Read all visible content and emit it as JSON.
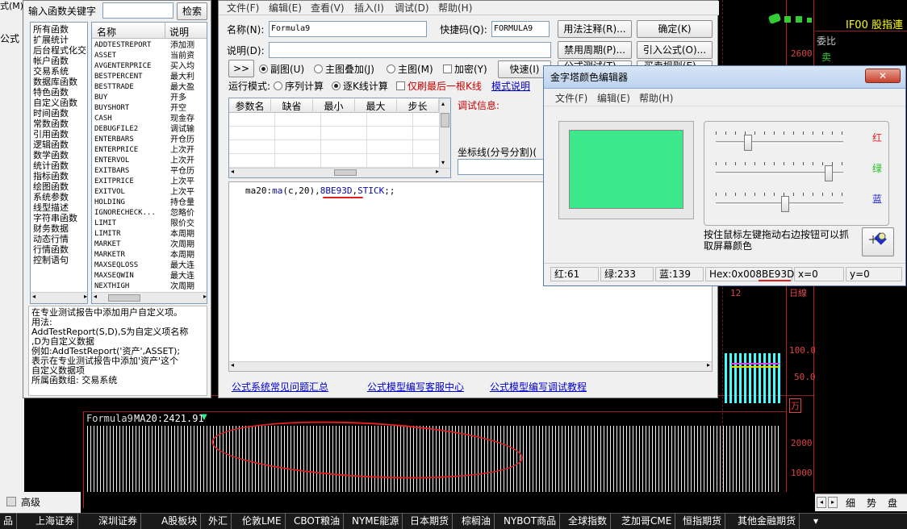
{
  "bg": {
    "top_left_menu": "式(M)",
    "side_label_gongshi": "公式",
    "chart_title": "Formula9",
    "chart_ma": "MA20:2421.91",
    "y_ticks_bottom": [
      "2000",
      "1000"
    ],
    "y_ticks_mid": [
      "100.0",
      "50.0",
      "万"
    ],
    "right_label_2600": "2600",
    "right_label_riding": "日線",
    "right_label_12": "12",
    "right_panel": {
      "ticker": "IF00 股指連",
      "weibi": "委比",
      "mai": "卖"
    },
    "bottom_left": "高级",
    "bottom_right_tabs": [
      "细",
      "势",
      "盘"
    ],
    "tabs": [
      "品",
      "上海证券",
      "深圳证券",
      "A股板块",
      "外汇",
      "伦敦LME",
      "CBOT粮油",
      "NYME能源",
      "日本期货",
      "棕榈油",
      "NYBOT商品",
      "全球指数",
      "芝加哥CME",
      "恒指期货",
      "其他金融期货"
    ],
    "tab_arrow": "▾"
  },
  "func_panel": {
    "search_label": "输入函数关键字",
    "search_value": "",
    "search_button": "检索",
    "categories": [
      "所有函数",
      "扩展统计",
      "后台程式化交易",
      "帐户函数",
      "交易系统",
      "数据库函数",
      "特色函数",
      "自定义函数",
      "时间函数",
      "常数函数",
      "引用函数",
      "逻辑函数",
      "数学函数",
      "统计函数",
      "指标函数",
      "绘图函数",
      "系统参数",
      "线型描述",
      "字符串函数",
      "财务数据",
      "动态行情",
      "行情函数",
      "控制语句"
    ],
    "col_name": "名称",
    "col_desc": "说明",
    "functions": [
      {
        "name": "ADDTESTREPORT",
        "desc": "添加测"
      },
      {
        "name": "ASSET",
        "desc": "当前资"
      },
      {
        "name": "AVGENTERPRICE",
        "desc": "买入均"
      },
      {
        "name": "BESTPERCENT",
        "desc": "最大利"
      },
      {
        "name": "BESTTRADE",
        "desc": "最大盈"
      },
      {
        "name": "BUY",
        "desc": "开多"
      },
      {
        "name": "BUYSHORT",
        "desc": "开空"
      },
      {
        "name": "CASH",
        "desc": "现金存"
      },
      {
        "name": "DEBUGFILE2",
        "desc": "调试输"
      },
      {
        "name": "ENTERBARS",
        "desc": "开仓历"
      },
      {
        "name": "ENTERPRICE",
        "desc": "上次开"
      },
      {
        "name": "ENTERVOL",
        "desc": "上次开"
      },
      {
        "name": "EXITBARS",
        "desc": "平仓历"
      },
      {
        "name": "EXITPRICE",
        "desc": "上次平"
      },
      {
        "name": "EXITVOL",
        "desc": "上次平"
      },
      {
        "name": "HOLDING",
        "desc": "持仓量"
      },
      {
        "name": "IGNORECHECK...",
        "desc": "忽略价"
      },
      {
        "name": "LIMIT",
        "desc": "限价交"
      },
      {
        "name": "LIMITR",
        "desc": "本周期"
      },
      {
        "name": "MARKET",
        "desc": "次周期"
      },
      {
        "name": "MARKETR",
        "desc": "本周期"
      },
      {
        "name": "MAXSEQLOSS",
        "desc": "最大连"
      },
      {
        "name": "MAXSEQWIN",
        "desc": "最大连"
      },
      {
        "name": "NEXTHIGH",
        "desc": "次周期"
      }
    ],
    "help_lines": [
      "在专业测试报告中添加用户自定义项。",
      "用法:",
      "AddTestReport(S,D),S为自定义项名称",
      ",D为自定义数据",
      "例如:AddTestReport('资产',ASSET);",
      "表示在专业测试报告中添加'资产'这个",
      "自定义数据项",
      "所属函数组: 交易系统"
    ]
  },
  "editor": {
    "menu": [
      "文件(F)",
      "编辑(E)",
      "查看(V)",
      "插入(I)",
      "调试(D)",
      "帮助(H)"
    ],
    "name_label": "名称(N):",
    "name_value": "Formula9",
    "shortcut_label": "快捷码(Q):",
    "shortcut_value": "FORMULA9",
    "desc_label": "说明(D):",
    "desc_value": "",
    "btn_annotate": "用法注释(R)...",
    "btn_ok": "确定(K)",
    "btn_disable_period": "禁用周期(P)...",
    "btn_import": "引入公式(O)...",
    "btn_test": "公式测试(T)...",
    "btn_compare": "买卖规则(E)...",
    "btn_expand": ">>",
    "btn_quick": "快速(I)",
    "radio_subplot": "副图(U)",
    "radio_overlay": "主图叠加(J)",
    "radio_main": "主图(M)",
    "chk_encrypt": "加密(Y)",
    "run_mode_label": "运行模式:",
    "radio_seq": "序列计算",
    "radio_bar": "逐K线计算",
    "chk_last_bar": "仅刷最后一根K线",
    "mode_help": "模式说明",
    "param_headers": [
      "参数名",
      "缺省",
      "最小",
      "最大",
      "步长"
    ],
    "debug_label": "调试信息:",
    "axis_label": "坐标线(分号分割)(",
    "code_prefix": "ma20:",
    "code_fn": "ma",
    "code_args": "(c,20),",
    "code_color": "8BE93D",
    "code_comma": ",",
    "code_stick": "STICK",
    "code_tail": ";;",
    "links": [
      "公式系统常见问题汇总",
      "公式模型编写客服中心",
      "公式模型编写调试教程"
    ]
  },
  "color_editor": {
    "title": "金字塔颜色编辑器",
    "menu": [
      "文件(F)",
      "编辑(E)",
      "帮助(H)"
    ],
    "label_red": "红",
    "label_green": "绿",
    "label_blue": "蓝",
    "red_value": 61,
    "green_value": 233,
    "blue_value": 139,
    "hint": "按住鼠标左键拖动右边按钮可以抓取屏幕颜色",
    "status_red": "红:61",
    "status_green": "绿:233",
    "status_blue": "蓝:139",
    "status_hex_prefix": "Hex:0x00",
    "status_hex_value": "8BE93D",
    "status_x": "x=0",
    "status_y": "y=0",
    "swatch_color": "#3DE98B",
    "label_red_color": "#e02020",
    "label_green_color": "#20c020",
    "label_blue_color": "#2020d0"
  }
}
